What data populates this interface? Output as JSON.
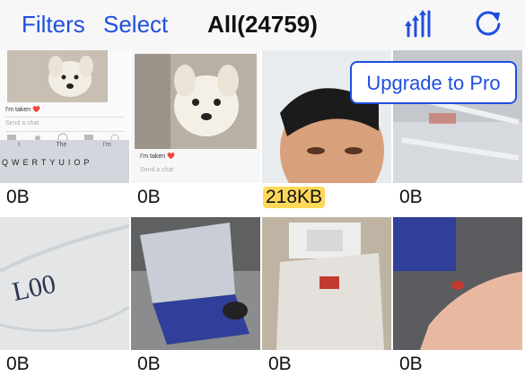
{
  "nav": {
    "filters_label": "Filters",
    "select_label": "Select",
    "title": "All(24759)",
    "sort_icon": "sort-bars-icon",
    "refresh_icon": "refresh-icon"
  },
  "upgrade_label": "Upgrade to Pro",
  "colors": {
    "accent": "#1f4fe0",
    "highlight": "#ffd85a"
  },
  "items": [
    {
      "size": "0B",
      "caption": "I'm taken ❤️",
      "placeholder": "Send a chat",
      "suggestions": [
        "I",
        "The",
        "I'm"
      ],
      "keys": "QWERTYUIOP"
    },
    {
      "size": "0B",
      "caption": "I'm taken ❤️",
      "placeholder": "Send a chat"
    },
    {
      "size": "218KB"
    },
    {
      "size": "0B"
    },
    {
      "size": "0B",
      "note": "L00"
    },
    {
      "size": "0B"
    },
    {
      "size": "0B"
    },
    {
      "size": "0B"
    }
  ]
}
